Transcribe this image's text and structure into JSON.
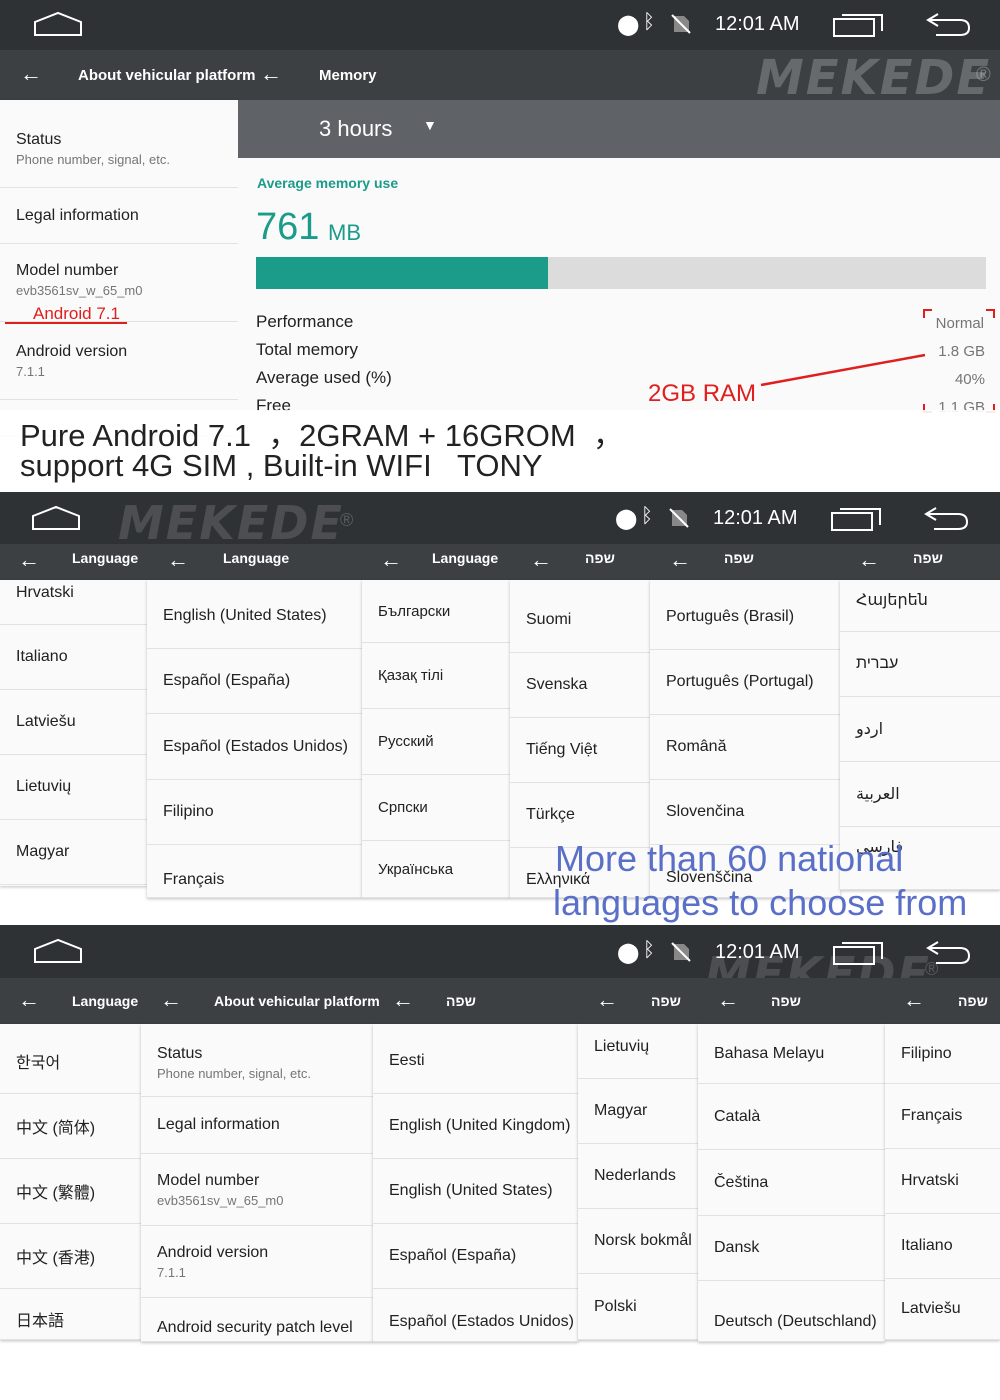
{
  "status_bar": {
    "clock": "12:01 AM"
  },
  "brand": {
    "watermark": "MEKEDE",
    "reg": "®"
  },
  "colors": {
    "statusbar": "#2f3235",
    "toolbar": "#3c4043",
    "accent": "#1b9b8a",
    "annotation_red": "#e01e1e",
    "annotation_blue": "#5a6fc8"
  },
  "section1": {
    "about_title": "About vehicular platform",
    "about_items": [
      {
        "title": "Status",
        "sub": "Phone number, signal, etc."
      },
      {
        "title": "Legal information",
        "sub": ""
      },
      {
        "title": "Model number",
        "sub": "evb3561sv_w_65_m0"
      },
      {
        "title": "Android version",
        "sub": "7.1.1"
      }
    ],
    "model_annotation": "Android 7.1",
    "memory_title": "Memory",
    "period": "3 hours",
    "avg_label": "Average memory use",
    "avg_value": "761",
    "avg_unit": "MB",
    "usage_fraction": 0.4,
    "stats": [
      {
        "label": "Performance",
        "value": "Normal"
      },
      {
        "label": "Total memory",
        "value": "1.8 GB"
      },
      {
        "label": "Average used (%)",
        "value": "40%"
      },
      {
        "label": "Free",
        "value": "1.1 GB"
      }
    ],
    "ram_annotation": "2GB RAM",
    "caption_line1": "Pure Android 7.1  ，2GRAM + 16GROM  ，",
    "caption_line2": "support 4G SIM , Built-in WIFI   TONY"
  },
  "section2": {
    "tabs": [
      "Language",
      "Language",
      "Language",
      "שפה",
      "שפה",
      "שפה"
    ],
    "col1": [
      "Hrvatski",
      "Italiano",
      "Latviešu",
      "Lietuvių",
      "Magyar"
    ],
    "col2": [
      "English (United States)",
      "Español (España)",
      "Español (Estados Unidos)",
      "Filipino",
      "Français"
    ],
    "col3": [
      "Български",
      "Қазақ тілі",
      "Русский",
      "Српски",
      "Українська"
    ],
    "col4": [
      "Suomi",
      "Svenska",
      "Tiếng Việt",
      "Türkçe",
      "Ελληνικά"
    ],
    "col5": [
      "Português (Brasil)",
      "Português (Portugal)",
      "Română",
      "Slovenčina",
      "Slovenščina"
    ],
    "col6": [
      "Հայերեն",
      "עברית",
      "اردو",
      "العربية",
      "فارسی"
    ],
    "annotation_line1": "More than 60 national",
    "annotation_line2": "languages to choose from"
  },
  "section3": {
    "tabs": [
      "Language",
      "About vehicular platform",
      "שפה",
      "שפה",
      "שפה",
      "שפה"
    ],
    "col1": [
      "한국어",
      "中文 (简体)",
      "中文 (繁體)",
      "中文 (香港)",
      "日本語"
    ],
    "col2": [
      {
        "title": "Status",
        "sub": "Phone number, signal, etc."
      },
      {
        "title": "Legal information",
        "sub": ""
      },
      {
        "title": "Model number",
        "sub": "evb3561sv_w_65_m0"
      },
      {
        "title": "Android version",
        "sub": "7.1.1"
      },
      {
        "title": "Android security patch level",
        "sub": ""
      }
    ],
    "col3": [
      "Eesti",
      "English (United Kingdom)",
      "English (United States)",
      "Español (España)",
      "Español (Estados Unidos)"
    ],
    "col4": [
      "Lietuvių",
      "Magyar",
      "Nederlands",
      "Norsk bokmål",
      "Polski"
    ],
    "col5": [
      "Bahasa Melayu",
      "Català",
      "Čeština",
      "Dansk",
      "Deutsch (Deutschland)"
    ],
    "col6": [
      "Filipino",
      "Français",
      "Hrvatski",
      "Italiano",
      "Latviešu"
    ]
  }
}
